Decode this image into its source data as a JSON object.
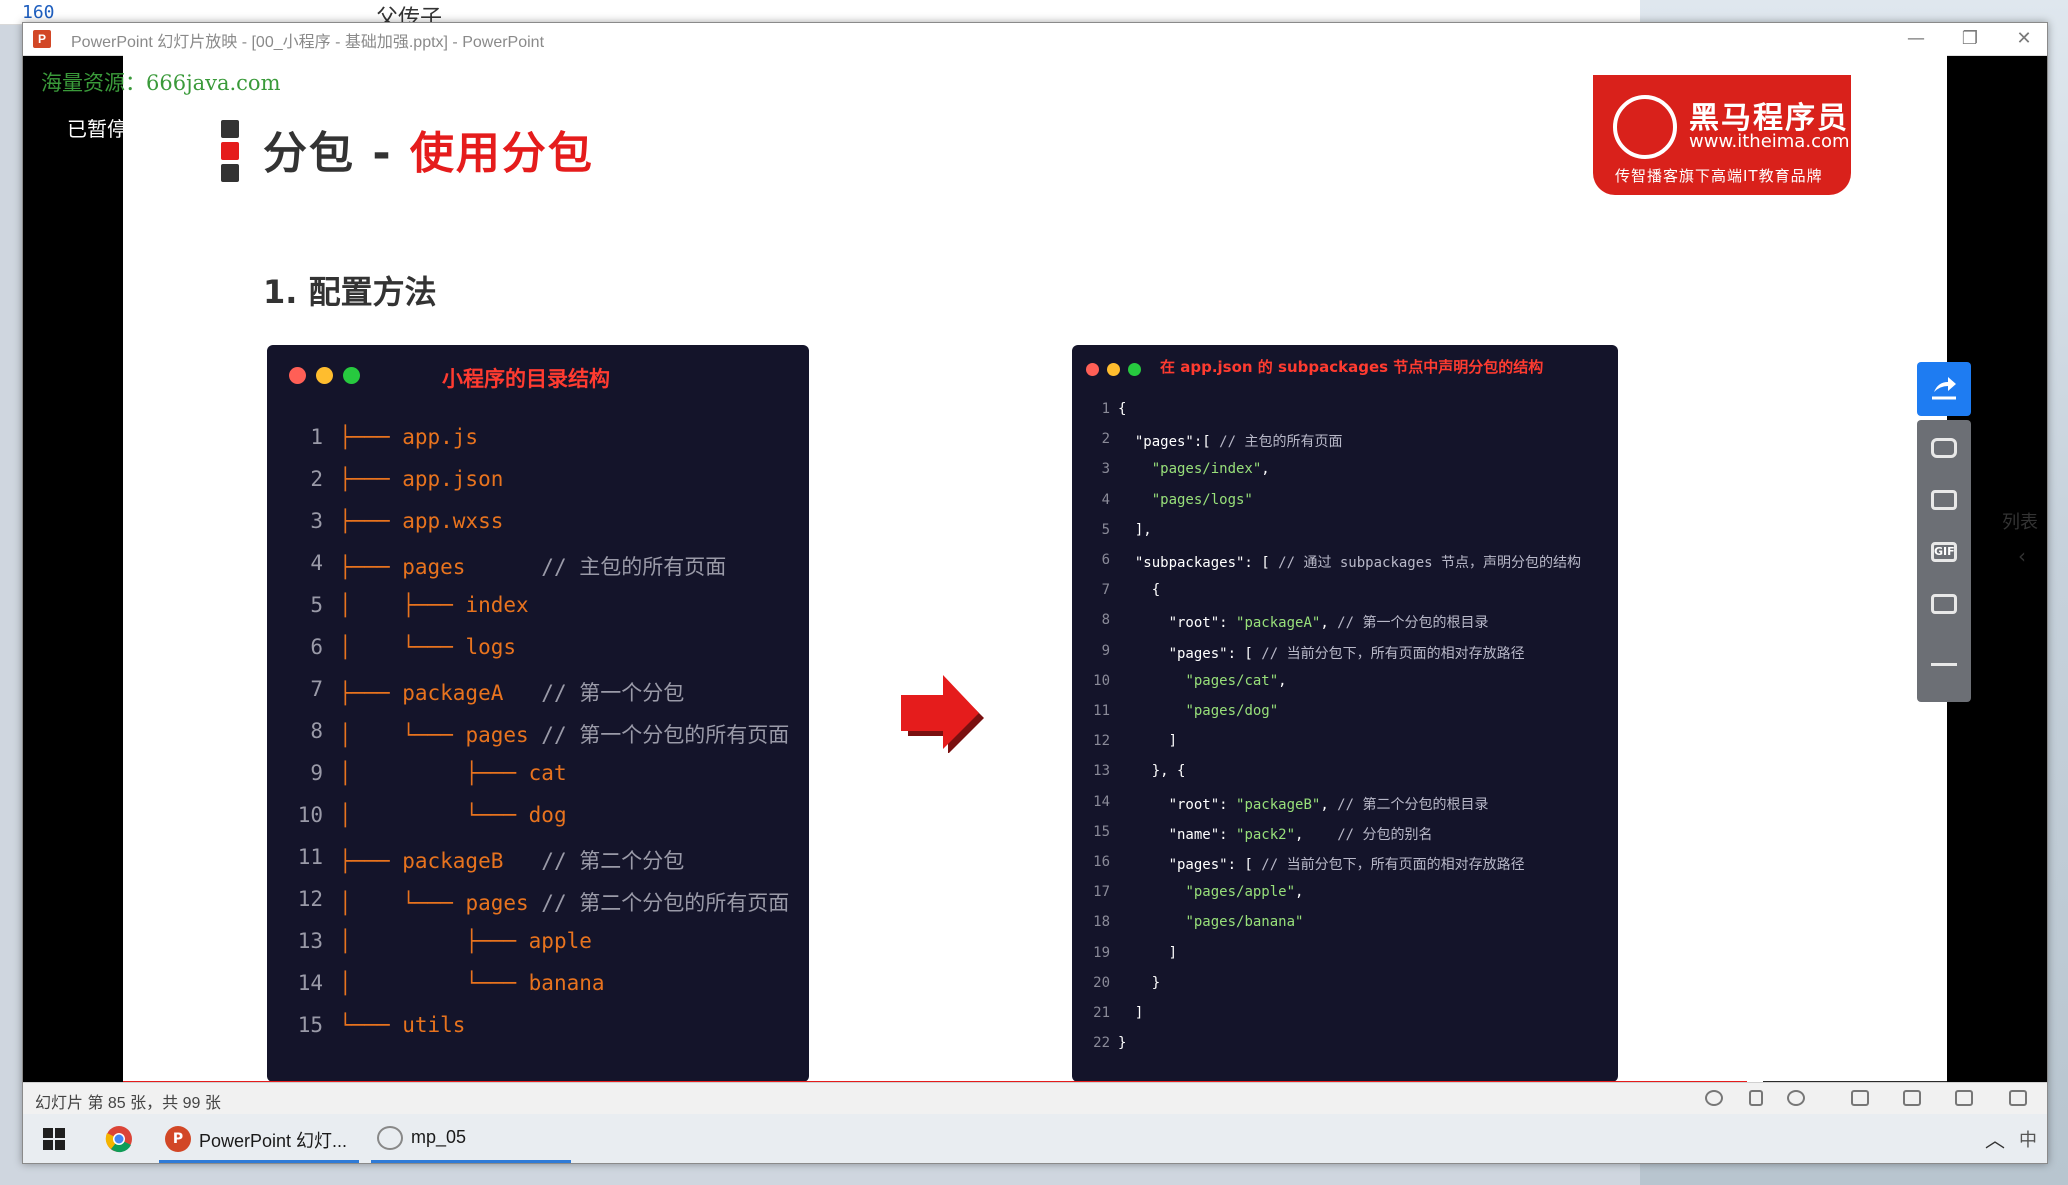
{
  "background": {
    "line_number": "160",
    "doc_word": "父传子"
  },
  "window": {
    "title": "PowerPoint 幻灯片放映 - [00_小程序 - 基础加强.pptx] - PowerPoint",
    "app_icon": "P",
    "minimize_icon": "—",
    "restore_icon": "❐",
    "close_icon": "✕"
  },
  "overlay": {
    "watermark": "海量资源：666java.com",
    "paused": "已暂停"
  },
  "slide": {
    "title_main": "分包 - ",
    "title_accent": "使用分包",
    "section": "1. 配置方法",
    "logo": {
      "name": "黑马程序员",
      "site": "www.itheima.com",
      "slogan": "传智播客旗下高端IT教育品牌"
    },
    "left_panel": {
      "title": "小程序的目录结构",
      "lines": [
        {
          "n": "1",
          "tree": "├─── ",
          "name": "app.js",
          "comment": ""
        },
        {
          "n": "2",
          "tree": "├─── ",
          "name": "app.json",
          "comment": ""
        },
        {
          "n": "3",
          "tree": "├─── ",
          "name": "app.wxss",
          "comment": ""
        },
        {
          "n": "4",
          "tree": "├─── ",
          "name": "pages",
          "comment": "      // 主包的所有页面"
        },
        {
          "n": "5",
          "tree": "│    ├─── ",
          "name": "index",
          "comment": ""
        },
        {
          "n": "6",
          "tree": "│    └─── ",
          "name": "logs",
          "comment": ""
        },
        {
          "n": "7",
          "tree": "├─── ",
          "name": "packageA",
          "comment": "   // 第一个分包"
        },
        {
          "n": "8",
          "tree": "│    └─── ",
          "name": "pages",
          "comment": " // 第一个分包的所有页面"
        },
        {
          "n": "9",
          "tree": "│         ├─── ",
          "name": "cat",
          "comment": ""
        },
        {
          "n": "10",
          "tree": "│         └─── ",
          "name": "dog",
          "comment": ""
        },
        {
          "n": "11",
          "tree": "├─── ",
          "name": "packageB",
          "comment": "   // 第二个分包"
        },
        {
          "n": "12",
          "tree": "│    └─── ",
          "name": "pages",
          "comment": " // 第二个分包的所有页面"
        },
        {
          "n": "13",
          "tree": "│         ├─── ",
          "name": "apple",
          "comment": ""
        },
        {
          "n": "14",
          "tree": "│         └─── ",
          "name": "banana",
          "comment": ""
        },
        {
          "n": "15",
          "tree": "└─── ",
          "name": "utils",
          "comment": ""
        }
      ]
    },
    "right_panel": {
      "title": "在 app.json 的 subpackages 节点中声明分包的结构",
      "lines": [
        {
          "n": "1",
          "code": "{",
          "str": "",
          "comment": ""
        },
        {
          "n": "2",
          "code": "  \"pages\":[ ",
          "str": "",
          "comment": "// 主包的所有页面"
        },
        {
          "n": "3",
          "code": "    ",
          "str": "\"pages/index\"",
          "tail": ",",
          "comment": ""
        },
        {
          "n": "4",
          "code": "    ",
          "str": "\"pages/logs\"",
          "comment": ""
        },
        {
          "n": "5",
          "code": "  ],",
          "str": "",
          "comment": ""
        },
        {
          "n": "6",
          "code": "  \"subpackages\": [ ",
          "str": "",
          "comment": "// 通过 subpackages 节点，声明分包的结构"
        },
        {
          "n": "7",
          "code": "    {",
          "str": "",
          "comment": ""
        },
        {
          "n": "8",
          "code": "      \"root\": ",
          "str": "\"packageA\"",
          "tail": ", ",
          "comment": "// 第一个分包的根目录"
        },
        {
          "n": "9",
          "code": "      \"pages\": [ ",
          "str": "",
          "comment": "// 当前分包下，所有页面的相对存放路径"
        },
        {
          "n": "10",
          "code": "        ",
          "str": "\"pages/cat\"",
          "tail": ",",
          "comment": ""
        },
        {
          "n": "11",
          "code": "        ",
          "str": "\"pages/dog\"",
          "comment": ""
        },
        {
          "n": "12",
          "code": "      ]",
          "str": "",
          "comment": ""
        },
        {
          "n": "13",
          "code": "    }, {",
          "str": "",
          "comment": ""
        },
        {
          "n": "14",
          "code": "      \"root\": ",
          "str": "\"packageB\"",
          "tail": ", ",
          "comment": "// 第二个分包的根目录"
        },
        {
          "n": "15",
          "code": "      \"name\": ",
          "str": "\"pack2\"",
          "tail": ",    ",
          "comment": "// 分包的别名"
        },
        {
          "n": "16",
          "code": "      \"pages\": [ ",
          "str": "",
          "comment": "// 当前分包下，所有页面的相对存放路径"
        },
        {
          "n": "17",
          "code": "        ",
          "str": "\"pages/apple\"",
          "tail": ",",
          "comment": ""
        },
        {
          "n": "18",
          "code": "        ",
          "str": "\"pages/banana\"",
          "comment": ""
        },
        {
          "n": "19",
          "code": "      ]",
          "str": "",
          "comment": ""
        },
        {
          "n": "20",
          "code": "    }",
          "str": "",
          "comment": ""
        },
        {
          "n": "21",
          "code": "  ]",
          "str": "",
          "comment": ""
        },
        {
          "n": "22",
          "code": "}",
          "str": "",
          "comment": ""
        }
      ]
    }
  },
  "right_toolbar": {
    "buttons": [
      "share-icon",
      "camera-icon",
      "image-icon",
      "gif-icon",
      "video-icon",
      "pen-icon"
    ],
    "gif_label": "GIF",
    "list_label": "列表",
    "chevron": "‹"
  },
  "status": {
    "text": "幻灯片 第 85 张，共 99 张"
  },
  "taskbar": {
    "items": [
      {
        "label": "PowerPoint 幻灯..."
      },
      {
        "label": "mp_05"
      }
    ],
    "tray_up": "︿",
    "ime": "中"
  },
  "colors": {
    "accent_red": "#e51c1c",
    "code_orange": "#e8731e",
    "code_bg": "#14142a",
    "string_green": "#98e07a",
    "toolbar_blue": "#1e7cf2"
  }
}
